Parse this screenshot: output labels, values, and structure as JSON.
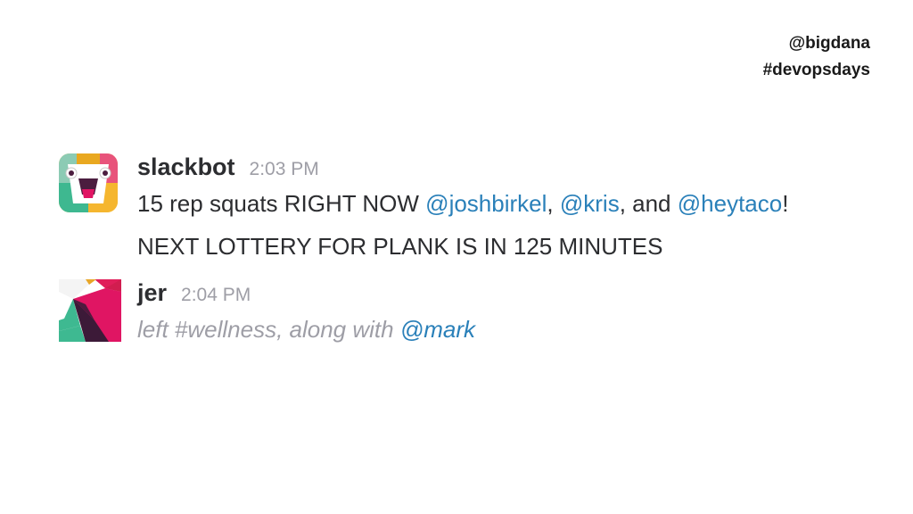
{
  "header": {
    "handle": "@bigdana",
    "hashtag": "#devopsdays"
  },
  "messages": [
    {
      "username": "slackbot",
      "time": "2:03 PM",
      "line1": {
        "text1": "15 rep squats RIGHT NOW ",
        "mention1": "@joshbirkel",
        "sep1": ", ",
        "mention2": "@kris",
        "sep2": ", and ",
        "mention3": "@heytaco",
        "end": "!"
      },
      "line2": "NEXT LOTTERY FOR PLANK IS IN 125 MINUTES"
    },
    {
      "username": "jer",
      "time": "2:04 PM",
      "line1": {
        "text1": "left #wellness, along with ",
        "mention1": "@mark"
      }
    }
  ],
  "colors": {
    "mention": "#2a80b9",
    "muted": "#9e9ea6",
    "text": "#2c2d30"
  },
  "icons": {
    "slackbot_avatar": "slackbot-avatar-icon",
    "jer_avatar": "slack-logo-avatar-icon"
  }
}
